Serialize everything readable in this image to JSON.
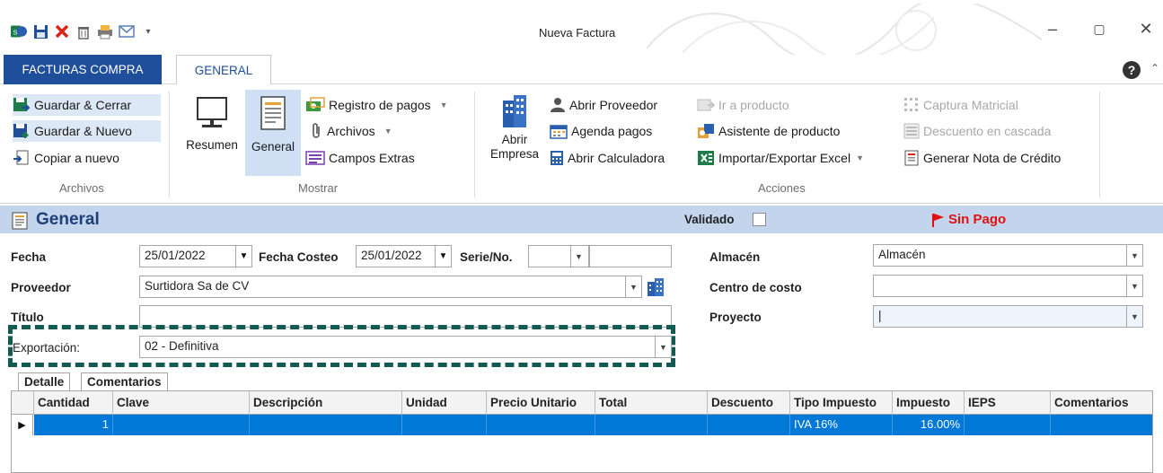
{
  "window": {
    "title": "Nueva Factura",
    "minimize": "–",
    "maximize": "▢",
    "close": "✕"
  },
  "tabs": {
    "app_tab": "FACTURAS COMPRA",
    "active_tab": "GENERAL",
    "help": "?"
  },
  "ribbon": {
    "archivos": {
      "label": "Archivos",
      "guardar_cerrar": "Guardar & Cerrar",
      "guardar_nuevo": "Guardar & Nuevo",
      "copiar_nuevo": "Copiar a nuevo"
    },
    "mostrar": {
      "label": "Mostrar",
      "resumen": "Resumen",
      "general": "General",
      "registro_pagos": "Registro de pagos",
      "archivos": "Archivos",
      "campos_extras": "Campos Extras"
    },
    "acciones": {
      "label": "Acciones",
      "abrir_empresa_1": "Abrir",
      "abrir_empresa_2": "Empresa",
      "abrir_proveedor": "Abrir Proveedor",
      "agenda_pagos": "Agenda pagos",
      "abrir_calculadora": "Abrir Calculadora",
      "ir_producto": "Ir a producto",
      "asistente_producto": "Asistente de producto",
      "importar_exportar": "Importar/Exportar Excel",
      "captura_matricial": "Captura Matricial",
      "descuento_cascada": "Descuento en cascada",
      "generar_nota": "Generar Nota de Crédito"
    }
  },
  "section": {
    "title": "General",
    "validado_label": "Validado",
    "status": "Sin Pago"
  },
  "form": {
    "fecha_label": "Fecha",
    "fecha_value": "25/01/2022",
    "fecha_costeo_label": "Fecha Costeo",
    "fecha_costeo_value": "25/01/2022",
    "serie_label": "Serie/No.",
    "serie_value": "",
    "numero_value": "",
    "proveedor_label": "Proveedor",
    "proveedor_value": "Surtidora Sa de CV",
    "titulo_label": "Título",
    "titulo_value": "",
    "exportacion_label": "Exportación:",
    "exportacion_value": "02 - Definitiva",
    "almacen_label": "Almacén",
    "almacen_value": "Almacén",
    "centro_costo_label": "Centro de costo",
    "centro_costo_value": "",
    "proyecto_label": "Proyecto",
    "proyecto_value": "|"
  },
  "detail_tabs": [
    "Detalle",
    "Comentarios"
  ],
  "grid": {
    "columns": [
      "Cantidad",
      "Clave",
      "Descripción",
      "Unidad",
      "Precio Unitario",
      "Total",
      "Descuento",
      "Tipo Impuesto",
      "Impuesto",
      "IEPS",
      "Comentarios"
    ],
    "rows": [
      [
        "1",
        "",
        "",
        "",
        "",
        "",
        "",
        "IVA 16%",
        "16.00%",
        "",
        ""
      ]
    ],
    "row_indicator": "▶"
  },
  "colors": {
    "brand_blue": "#1f4e9a",
    "section_bg": "#c2d5ec",
    "selection": "#0078d7",
    "highlight_dashed": "#125a52",
    "status_red": "#e01010"
  }
}
